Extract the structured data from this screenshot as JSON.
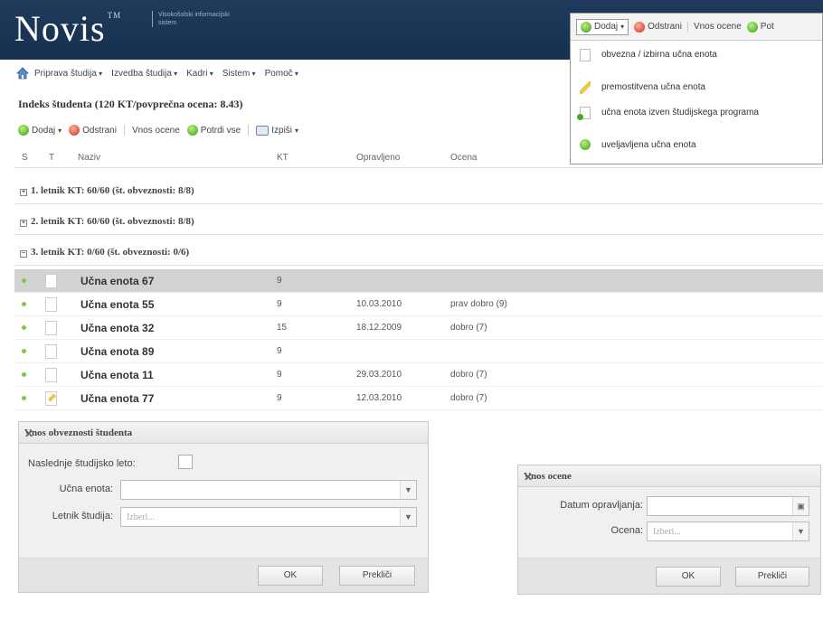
{
  "header": {
    "logo": "Novis",
    "tm": "TM",
    "tagline": "Visokošolski informacijski sistem"
  },
  "menu": {
    "items": [
      "Priprava študija",
      "Izvedba študija",
      "Kadri",
      "Sistem",
      "Pomoč"
    ]
  },
  "panel": {
    "title": "Indeks študenta (120 KT/povprečna ocena: 8.43)"
  },
  "toolbar": {
    "add": "Dodaj",
    "remove": "Odstrani",
    "enter_grades": "Vnos ocene",
    "confirm_all": "Potrdi vse",
    "print": "Izpiši"
  },
  "columns": {
    "s": "S",
    "t": "T",
    "name": "Naziv",
    "kt": "KT",
    "done": "Opravljeno",
    "grade": "Ocena"
  },
  "groups": [
    "1. letnik KT: 60/60 (št. obveznosti: 8/8)",
    "2. letnik KT: 60/60 (št. obveznosti: 8/8)",
    "3. letnik KT: 0/60 (št. obveznosti: 0/6)"
  ],
  "rows": [
    {
      "name": "Učna enota 67",
      "kt": "9",
      "date": "",
      "grade": ""
    },
    {
      "name": "Učna enota 55",
      "kt": "9",
      "date": "10.03.2010",
      "grade": "prav dobro (9)"
    },
    {
      "name": "Učna enota 32",
      "kt": "15",
      "date": "18.12.2009",
      "grade": "dobro (7)"
    },
    {
      "name": "Učna enota 89",
      "kt": "9",
      "date": "",
      "grade": ""
    },
    {
      "name": "Učna enota 11",
      "kt": "9",
      "date": "29.03.2010",
      "grade": "dobro (7)"
    },
    {
      "name": "Učna enota 77",
      "kt": "9",
      "date": "12.03.2010",
      "grade": "dobro (7)"
    }
  ],
  "dialog_obligation": {
    "title": "Vnos obveznosti študenta",
    "next_year_label": "Naslednje študijsko leto:",
    "unit_label": "Učna enota:",
    "year_label": "Letnik študija:",
    "year_placeholder": "Izberi...",
    "ok": "OK",
    "cancel": "Prekliči"
  },
  "dialog_grade": {
    "title": "Vnos ocene",
    "date_label": "Datum opravljanja:",
    "grade_label": "Ocena:",
    "grade_placeholder": "Izberi...",
    "ok": "OK",
    "cancel": "Prekliči"
  },
  "dropdown": {
    "bar_add": "Dodaj",
    "bar_remove": "Odstrani",
    "bar_grades": "Vnos ocene",
    "bar_confirm": "Pot",
    "items": [
      "obvezna / izbirna učna enota",
      "premostitvena učna enota",
      "učna enota izven študijskega programa",
      "uveljavljena učna enota"
    ]
  }
}
